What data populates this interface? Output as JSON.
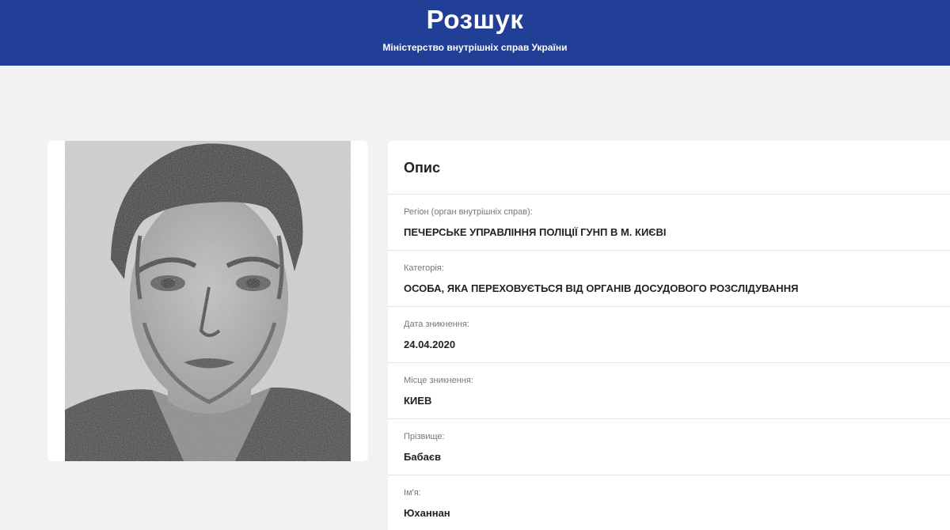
{
  "header": {
    "title": "Розшук",
    "subtitle": "Міністерство внутрішніх справ України"
  },
  "info": {
    "title": "Опис",
    "fields": [
      {
        "label": "Регіон (орган внутрішніх справ):",
        "value": "ПЕЧЕРСЬКЕ УПРАВЛІННЯ ПОЛІЦІЇ ГУНП В М. КИЄВІ"
      },
      {
        "label": "Категорія:",
        "value": "ОСОБА, ЯКА ПЕРЕХОВУЄТЬСЯ ВІД ОРГАНІВ ДОСУДОВОГО РОЗСЛІДУВАННЯ"
      },
      {
        "label": "Дата зникнення:",
        "value": "24.04.2020"
      },
      {
        "label": "Місце зникнення:",
        "value": "КИЕВ"
      },
      {
        "label": "Прізвище:",
        "value": "Бабаєв"
      },
      {
        "label": "Ім'я:",
        "value": "Юханнан"
      }
    ]
  },
  "colors": {
    "header_bg": "#213f97",
    "page_bg": "#f2f2f2",
    "card_bg": "#ffffff"
  }
}
